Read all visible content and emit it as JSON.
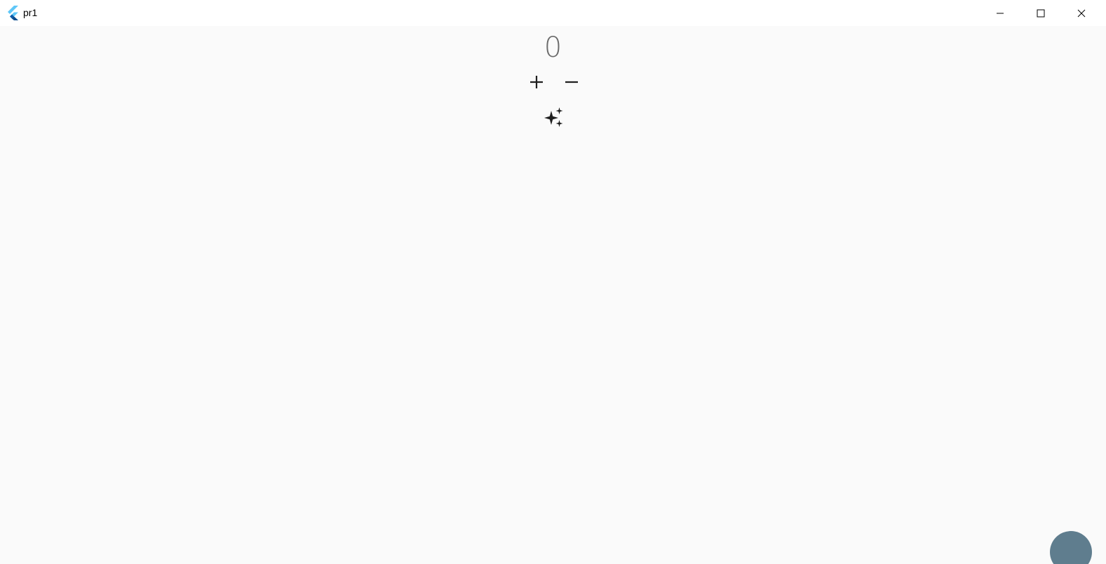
{
  "window": {
    "title": "pr1",
    "controls": {
      "minimize": "minimize-icon",
      "maximize": "maximize-icon",
      "close": "close-icon"
    }
  },
  "main": {
    "counter_value": "0",
    "buttons": {
      "increment_icon": "plus-icon",
      "decrement_icon": "minus-icon",
      "sparkle_icon": "sparkle-icon"
    }
  },
  "colors": {
    "titlebar_bg": "#ffffff",
    "content_bg": "#fafafa",
    "counter_text": "#6b6b6b",
    "icon_color": "#1f1f1f",
    "fab_color": "#5f7d8e"
  }
}
